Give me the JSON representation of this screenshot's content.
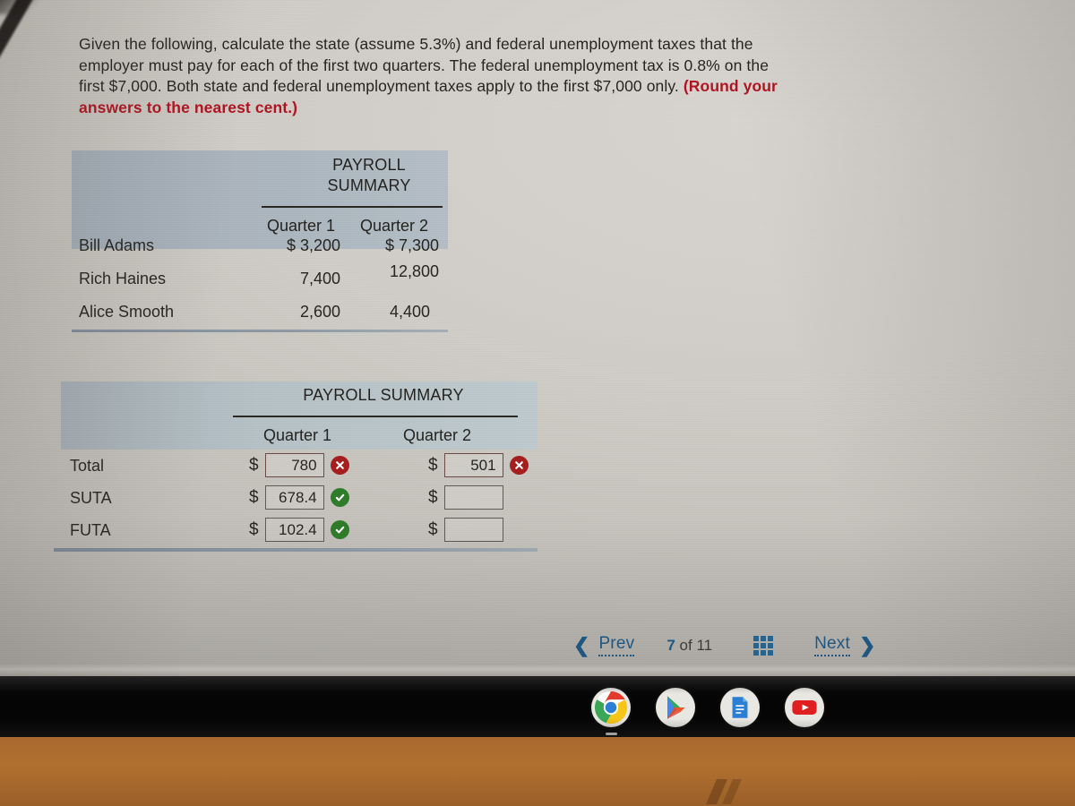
{
  "question": {
    "line1": "Given the following, calculate the state (assume 5.3%) and federal unemployment taxes",
    "line2": "that the employer must pay for each of the first two quarters. The federal unemployment",
    "line3": "tax is 0.8% on the first $7,000. Both state and federal unemployment taxes apply to the",
    "line4_prefix": "first $7,000 only. ",
    "line4_highlight": "(Round your answers to the nearest cent.)"
  },
  "payroll_table": {
    "title_line1": "PAYROLL",
    "title_line2": "SUMMARY",
    "col1": "Quarter 1",
    "col2": "Quarter 2",
    "rows": [
      {
        "name": "Bill Adams",
        "q1": "$ 3,200",
        "q2": "$ 7,300"
      },
      {
        "name": "Rich Haines",
        "q1": "7,400",
        "q2": "12,800"
      },
      {
        "name": "Alice Smooth",
        "q1": "2,600",
        "q2": "4,400"
      }
    ]
  },
  "answer_table": {
    "title": "PAYROLL SUMMARY",
    "col1": "Quarter 1",
    "col2": "Quarter 2",
    "currency_symbol": "$",
    "rows": [
      {
        "label": "Total",
        "q1_value": "780",
        "q1_status": "incorrect",
        "q2_value": "501",
        "q2_status": "incorrect"
      },
      {
        "label": "SUTA",
        "q1_value": "678.4",
        "q1_status": "correct",
        "q2_value": "",
        "q2_status": "none"
      },
      {
        "label": "FUTA",
        "q1_value": "102.4",
        "q1_status": "correct",
        "q2_value": "",
        "q2_status": "none"
      }
    ]
  },
  "pager": {
    "prev_label": "Prev",
    "next_label": "Next",
    "current_page": "7",
    "of_label": "of",
    "total_pages": "11",
    "grid_icon": "grid-icon"
  },
  "shelf": {
    "icons": [
      "chrome-icon",
      "play-store-icon",
      "google-docs-icon",
      "youtube-icon"
    ]
  },
  "colors": {
    "accent_link": "#19598c",
    "highlight_red": "#b01320",
    "correct_green": "#2e7a29",
    "incorrect_red": "#a41d1d",
    "table_band": "#aab4bd"
  }
}
